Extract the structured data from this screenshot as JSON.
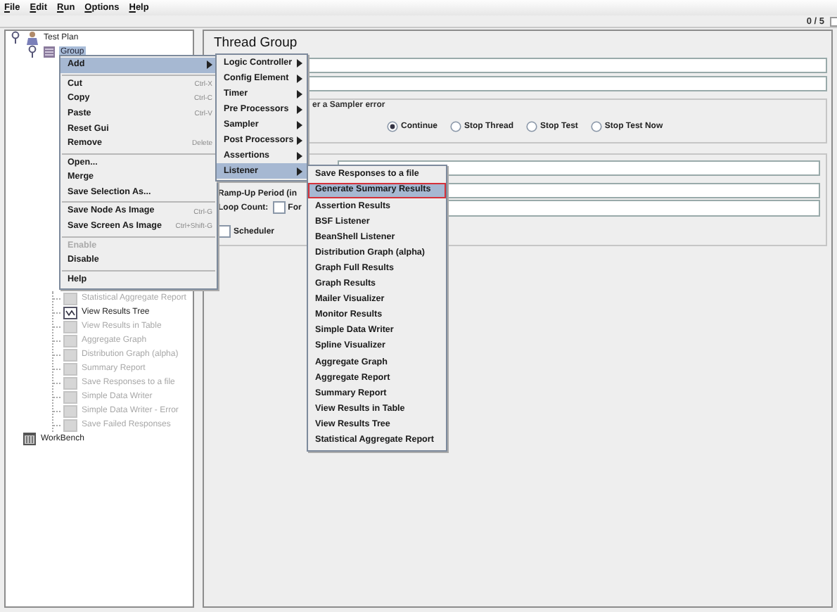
{
  "menu_bar": [
    "File",
    "Edit",
    "Run",
    "Options",
    "Help"
  ],
  "counter": "0 / 5",
  "tree": {
    "nodes": [
      {
        "label": "Test Plan",
        "kind": "plan",
        "expanded": true,
        "selected": false,
        "children": [
          {
            "label": "Group",
            "kind": "thread_group",
            "expanded": true,
            "selected": true
          }
        ]
      }
    ],
    "partly_hidden_nodes": [
      {
        "label": "Statistical Aggregate Report",
        "kind": "listener",
        "disabled": true
      },
      {
        "label": "View Results Tree",
        "kind": "results_tree",
        "disabled": false
      },
      {
        "label": "View Results in Table",
        "kind": "listener",
        "disabled": true
      },
      {
        "label": "Aggregate Graph",
        "kind": "listener",
        "disabled": true
      },
      {
        "label": "Distribution Graph (alpha)",
        "kind": "listener",
        "disabled": true
      },
      {
        "label": "Summary Report",
        "kind": "listener",
        "disabled": true
      },
      {
        "label": "Save Responses to a file",
        "kind": "listener",
        "disabled": true
      },
      {
        "label": "Simple Data Writer",
        "kind": "listener",
        "disabled": true
      },
      {
        "label": "Simple Data Writer - Error",
        "kind": "listener",
        "disabled": true
      },
      {
        "label": "Save Failed Responses",
        "kind": "listener",
        "disabled": true
      }
    ],
    "workbench": {
      "label": "WorkBench"
    }
  },
  "panel": {
    "title": "Thread Group",
    "sampler_error": {
      "legend": "er a Sampler error",
      "options": [
        {
          "label": "Continue",
          "selected": true
        },
        {
          "label": "Stop Thread",
          "selected": false
        },
        {
          "label": "Stop Test",
          "selected": false
        },
        {
          "label": "Stop Test Now",
          "selected": false
        }
      ]
    },
    "ramp_up_label": "Ramp-Up Period (in",
    "loop_count": {
      "label": "Loop Count:",
      "forever": {
        "label": "For",
        "checked": false
      }
    },
    "scheduler": {
      "label": "Scheduler",
      "checked": false
    }
  },
  "context_menu": {
    "items": [
      {
        "kind": "item",
        "label": "Add",
        "submenu": true,
        "selected": true,
        "disabled": false
      },
      {
        "kind": "separator"
      },
      {
        "kind": "item",
        "label": "Cut",
        "shortcut": "Ctrl-X",
        "submenu": false,
        "selected": false,
        "disabled": false
      },
      {
        "kind": "item",
        "label": "Copy",
        "shortcut": "Ctrl-C",
        "submenu": false,
        "selected": false,
        "disabled": false
      },
      {
        "kind": "item",
        "label": "Paste",
        "shortcut": "Ctrl-V",
        "submenu": false,
        "selected": false,
        "disabled": false
      },
      {
        "kind": "item",
        "label": "Reset Gui",
        "submenu": false,
        "selected": false,
        "disabled": false
      },
      {
        "kind": "item",
        "label": "Remove",
        "shortcut": "Delete",
        "submenu": false,
        "selected": false,
        "disabled": false
      },
      {
        "kind": "separator"
      },
      {
        "kind": "item",
        "label": "Open...",
        "submenu": false,
        "selected": false,
        "disabled": false
      },
      {
        "kind": "item",
        "label": "Merge",
        "submenu": false,
        "selected": false,
        "disabled": false
      },
      {
        "kind": "item",
        "label": "Save Selection As...",
        "submenu": false,
        "selected": false,
        "disabled": false
      },
      {
        "kind": "separator"
      },
      {
        "kind": "item",
        "label": "Save Node As Image",
        "shortcut": "Ctrl-G",
        "submenu": false,
        "selected": false,
        "disabled": false
      },
      {
        "kind": "item",
        "label": "Save Screen As Image",
        "shortcut": "Ctrl+Shift-G",
        "submenu": false,
        "selected": false,
        "disabled": false
      },
      {
        "kind": "separator"
      },
      {
        "kind": "item",
        "label": "Enable",
        "submenu": false,
        "selected": false,
        "disabled": true
      },
      {
        "kind": "item",
        "label": "Disable",
        "submenu": false,
        "selected": false,
        "disabled": false
      },
      {
        "kind": "separator"
      },
      {
        "kind": "item",
        "label": "Help",
        "submenu": false,
        "selected": false,
        "disabled": false
      }
    ]
  },
  "add_submenu": {
    "items": [
      {
        "kind": "item",
        "label": "Logic Controller",
        "submenu": true,
        "selected": false
      },
      {
        "kind": "item",
        "label": "Config Element",
        "submenu": true,
        "selected": false
      },
      {
        "kind": "item",
        "label": "Timer",
        "submenu": true,
        "selected": false
      },
      {
        "kind": "item",
        "label": "Pre Processors",
        "submenu": true,
        "selected": false
      },
      {
        "kind": "item",
        "label": "Sampler",
        "submenu": true,
        "selected": false
      },
      {
        "kind": "item",
        "label": "Post Processors",
        "submenu": true,
        "selected": false
      },
      {
        "kind": "item",
        "label": "Assertions",
        "submenu": true,
        "selected": false
      },
      {
        "kind": "item",
        "label": "Listener",
        "submenu": true,
        "selected": true
      }
    ]
  },
  "listener_submenu": {
    "items": [
      {
        "kind": "item",
        "label": "Save Responses to a file",
        "selected": false,
        "outlined": false
      },
      {
        "kind": "item",
        "label": "Generate Summary Results",
        "selected": true,
        "outlined": true
      },
      {
        "kind": "item",
        "label": "Assertion Results",
        "selected": false,
        "outlined": false
      },
      {
        "kind": "item",
        "label": "BSF Listener",
        "selected": false,
        "outlined": false
      },
      {
        "kind": "item",
        "label": "BeanShell Listener",
        "selected": false,
        "outlined": false
      },
      {
        "kind": "item",
        "label": "Distribution Graph (alpha)",
        "selected": false,
        "outlined": false
      },
      {
        "kind": "item",
        "label": "Graph Full Results",
        "selected": false,
        "outlined": false
      },
      {
        "kind": "item",
        "label": "Graph Results",
        "selected": false,
        "outlined": false
      },
      {
        "kind": "item",
        "label": "Mailer Visualizer",
        "selected": false,
        "outlined": false
      },
      {
        "kind": "item",
        "label": "Monitor Results",
        "selected": false,
        "outlined": false
      },
      {
        "kind": "item",
        "label": "Simple Data Writer",
        "selected": false,
        "outlined": false
      },
      {
        "kind": "item",
        "label": "Spline Visualizer",
        "selected": false,
        "outlined": false
      },
      {
        "kind": "item",
        "label": "Aggregate Graph",
        "selected": false,
        "outlined": false
      },
      {
        "kind": "item",
        "label": "Aggregate Report",
        "selected": false,
        "outlined": false
      },
      {
        "kind": "item",
        "label": "Summary Report",
        "selected": false,
        "outlined": false
      },
      {
        "kind": "item",
        "label": "View Results in Table",
        "selected": false,
        "outlined": false
      },
      {
        "kind": "item",
        "label": "View Results Tree",
        "selected": false,
        "outlined": false
      },
      {
        "kind": "item",
        "label": "Statistical Aggregate Report",
        "selected": false,
        "outlined": false
      }
    ]
  }
}
